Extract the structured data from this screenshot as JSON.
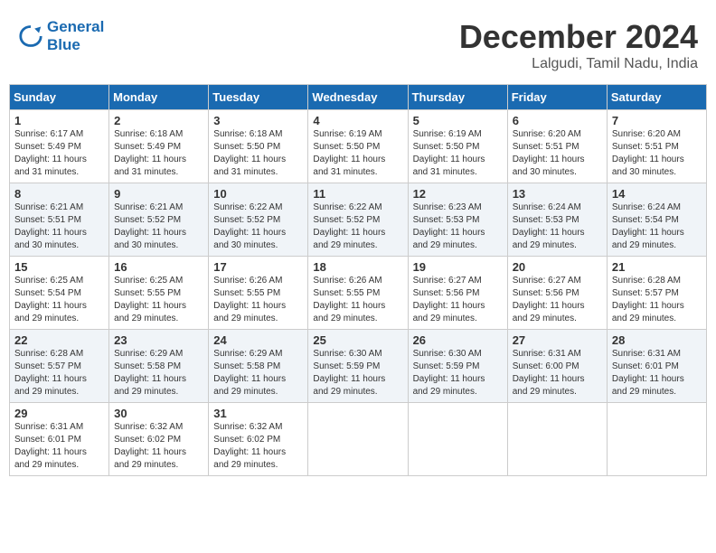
{
  "header": {
    "logo_line1": "General",
    "logo_line2": "Blue",
    "month": "December 2024",
    "location": "Lalgudi, Tamil Nadu, India"
  },
  "weekdays": [
    "Sunday",
    "Monday",
    "Tuesday",
    "Wednesday",
    "Thursday",
    "Friday",
    "Saturday"
  ],
  "weeks": [
    [
      {
        "day": "1",
        "info": "Sunrise: 6:17 AM\nSunset: 5:49 PM\nDaylight: 11 hours\nand 31 minutes."
      },
      {
        "day": "2",
        "info": "Sunrise: 6:18 AM\nSunset: 5:49 PM\nDaylight: 11 hours\nand 31 minutes."
      },
      {
        "day": "3",
        "info": "Sunrise: 6:18 AM\nSunset: 5:50 PM\nDaylight: 11 hours\nand 31 minutes."
      },
      {
        "day": "4",
        "info": "Sunrise: 6:19 AM\nSunset: 5:50 PM\nDaylight: 11 hours\nand 31 minutes."
      },
      {
        "day": "5",
        "info": "Sunrise: 6:19 AM\nSunset: 5:50 PM\nDaylight: 11 hours\nand 31 minutes."
      },
      {
        "day": "6",
        "info": "Sunrise: 6:20 AM\nSunset: 5:51 PM\nDaylight: 11 hours\nand 30 minutes."
      },
      {
        "day": "7",
        "info": "Sunrise: 6:20 AM\nSunset: 5:51 PM\nDaylight: 11 hours\nand 30 minutes."
      }
    ],
    [
      {
        "day": "8",
        "info": "Sunrise: 6:21 AM\nSunset: 5:51 PM\nDaylight: 11 hours\nand 30 minutes."
      },
      {
        "day": "9",
        "info": "Sunrise: 6:21 AM\nSunset: 5:52 PM\nDaylight: 11 hours\nand 30 minutes."
      },
      {
        "day": "10",
        "info": "Sunrise: 6:22 AM\nSunset: 5:52 PM\nDaylight: 11 hours\nand 30 minutes."
      },
      {
        "day": "11",
        "info": "Sunrise: 6:22 AM\nSunset: 5:52 PM\nDaylight: 11 hours\nand 29 minutes."
      },
      {
        "day": "12",
        "info": "Sunrise: 6:23 AM\nSunset: 5:53 PM\nDaylight: 11 hours\nand 29 minutes."
      },
      {
        "day": "13",
        "info": "Sunrise: 6:24 AM\nSunset: 5:53 PM\nDaylight: 11 hours\nand 29 minutes."
      },
      {
        "day": "14",
        "info": "Sunrise: 6:24 AM\nSunset: 5:54 PM\nDaylight: 11 hours\nand 29 minutes."
      }
    ],
    [
      {
        "day": "15",
        "info": "Sunrise: 6:25 AM\nSunset: 5:54 PM\nDaylight: 11 hours\nand 29 minutes."
      },
      {
        "day": "16",
        "info": "Sunrise: 6:25 AM\nSunset: 5:55 PM\nDaylight: 11 hours\nand 29 minutes."
      },
      {
        "day": "17",
        "info": "Sunrise: 6:26 AM\nSunset: 5:55 PM\nDaylight: 11 hours\nand 29 minutes."
      },
      {
        "day": "18",
        "info": "Sunrise: 6:26 AM\nSunset: 5:55 PM\nDaylight: 11 hours\nand 29 minutes."
      },
      {
        "day": "19",
        "info": "Sunrise: 6:27 AM\nSunset: 5:56 PM\nDaylight: 11 hours\nand 29 minutes."
      },
      {
        "day": "20",
        "info": "Sunrise: 6:27 AM\nSunset: 5:56 PM\nDaylight: 11 hours\nand 29 minutes."
      },
      {
        "day": "21",
        "info": "Sunrise: 6:28 AM\nSunset: 5:57 PM\nDaylight: 11 hours\nand 29 minutes."
      }
    ],
    [
      {
        "day": "22",
        "info": "Sunrise: 6:28 AM\nSunset: 5:57 PM\nDaylight: 11 hours\nand 29 minutes."
      },
      {
        "day": "23",
        "info": "Sunrise: 6:29 AM\nSunset: 5:58 PM\nDaylight: 11 hours\nand 29 minutes."
      },
      {
        "day": "24",
        "info": "Sunrise: 6:29 AM\nSunset: 5:58 PM\nDaylight: 11 hours\nand 29 minutes."
      },
      {
        "day": "25",
        "info": "Sunrise: 6:30 AM\nSunset: 5:59 PM\nDaylight: 11 hours\nand 29 minutes."
      },
      {
        "day": "26",
        "info": "Sunrise: 6:30 AM\nSunset: 5:59 PM\nDaylight: 11 hours\nand 29 minutes."
      },
      {
        "day": "27",
        "info": "Sunrise: 6:31 AM\nSunset: 6:00 PM\nDaylight: 11 hours\nand 29 minutes."
      },
      {
        "day": "28",
        "info": "Sunrise: 6:31 AM\nSunset: 6:01 PM\nDaylight: 11 hours\nand 29 minutes."
      }
    ],
    [
      {
        "day": "29",
        "info": "Sunrise: 6:31 AM\nSunset: 6:01 PM\nDaylight: 11 hours\nand 29 minutes."
      },
      {
        "day": "30",
        "info": "Sunrise: 6:32 AM\nSunset: 6:02 PM\nDaylight: 11 hours\nand 29 minutes."
      },
      {
        "day": "31",
        "info": "Sunrise: 6:32 AM\nSunset: 6:02 PM\nDaylight: 11 hours\nand 29 minutes."
      },
      {
        "day": "",
        "info": ""
      },
      {
        "day": "",
        "info": ""
      },
      {
        "day": "",
        "info": ""
      },
      {
        "day": "",
        "info": ""
      }
    ]
  ]
}
